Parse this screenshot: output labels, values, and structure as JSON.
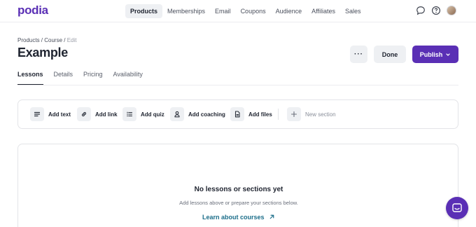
{
  "brand": {
    "logo_text": "podia",
    "accent": "#5a2fb5"
  },
  "nav": {
    "items": [
      {
        "label": "Products",
        "active": true
      },
      {
        "label": "Memberships"
      },
      {
        "label": "Email"
      },
      {
        "label": "Coupons"
      },
      {
        "label": "Audience"
      },
      {
        "label": "Affiliates"
      },
      {
        "label": "Sales"
      }
    ],
    "icons": [
      "chat-bubble-icon",
      "help-icon",
      "avatar"
    ]
  },
  "breadcrumb": {
    "part1": "Products",
    "sep1": " / ",
    "part2": "Course",
    "sep2": " / ",
    "current": "Edit"
  },
  "page": {
    "title": "Example"
  },
  "actions": {
    "more_label": "···",
    "done_label": "Done",
    "publish_label": "Publish",
    "publish_icon": "chevron-down-icon"
  },
  "tabs": [
    {
      "label": "Lessons",
      "active": true
    },
    {
      "label": "Details"
    },
    {
      "label": "Pricing"
    },
    {
      "label": "Availability"
    }
  ],
  "toolbar": {
    "add_text": "Add text",
    "add_link": "Add link",
    "add_quiz": "Add quiz",
    "add_coaching": "Add coaching",
    "add_files": "Add files",
    "new_section": "New section"
  },
  "empty_state": {
    "title": "No lessons or sections yet",
    "subtitle": "Add lessons above or prepare your sections below.",
    "link_label": "Learn about courses",
    "link_icon": "arrow-up-right-icon",
    "link_color": "#1c6e8a"
  },
  "chat_widget": {
    "icon": "chat-icon"
  }
}
